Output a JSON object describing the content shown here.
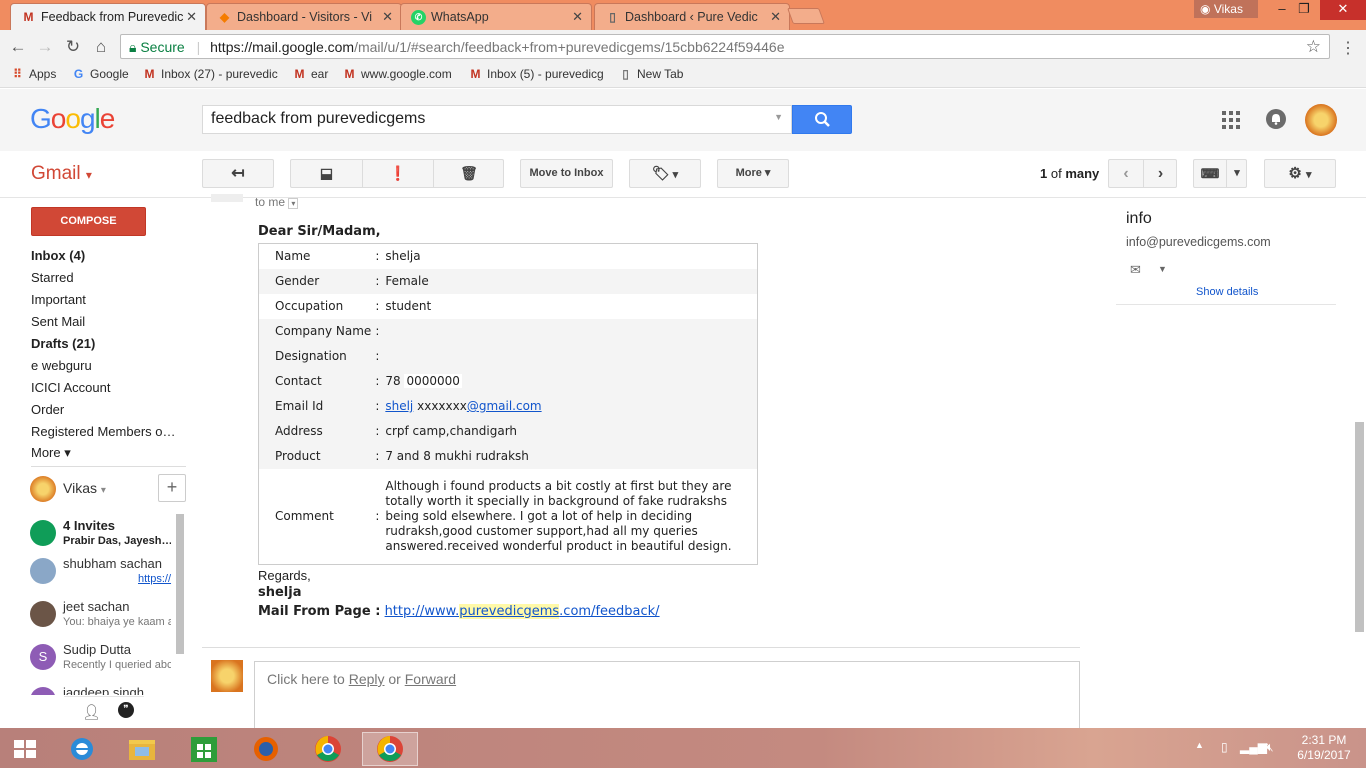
{
  "browser": {
    "tabs": [
      {
        "title": "Feedback from Purevedic",
        "icon": "gmail-icon",
        "active": true
      },
      {
        "title": "Dashboard - Visitors - Vi",
        "icon": "dashboard-icon",
        "active": false
      },
      {
        "title": "WhatsApp",
        "icon": "whatsapp-icon",
        "active": false
      },
      {
        "title": "Dashboard ‹ Pure Vedic",
        "icon": "page-icon",
        "active": false
      }
    ],
    "profile_name": "Vikas",
    "secure_label": "Secure",
    "url_host": "https://mail.google.com",
    "url_path": "/mail/u/1/#search/feedback+from+purevedicgems/15cbb6224f59446e",
    "bookmarks": [
      {
        "label": "Apps",
        "icon": "apps-grid-icon"
      },
      {
        "label": "Google",
        "icon": "google-g-icon"
      },
      {
        "label": "Inbox (27) - purevedic",
        "icon": "gmail-icon"
      },
      {
        "label": "ear",
        "icon": "gmail-icon"
      },
      {
        "label": "www.google.com",
        "icon": "gmail-icon"
      },
      {
        "label": "Inbox (5) - purevedicg",
        "icon": "gmail-icon"
      },
      {
        "label": "New Tab",
        "icon": "page-icon"
      }
    ]
  },
  "gmail": {
    "logo": "Google",
    "search_value": "feedback from purevedicgems",
    "app_label": "Gmail",
    "toolbar": {
      "move_to_inbox": "Move to Inbox",
      "more": "More",
      "page_count": "1",
      "page_of": "of",
      "page_total": "many"
    },
    "nav": {
      "compose": "COMPOSE",
      "items": [
        {
          "label": "Inbox (4)",
          "bold": true
        },
        {
          "label": "Starred",
          "bold": false
        },
        {
          "label": "Important",
          "bold": false
        },
        {
          "label": "Sent Mail",
          "bold": false
        },
        {
          "label": "Drafts (21)",
          "bold": true
        },
        {
          "label": "e webguru",
          "bold": false
        },
        {
          "label": "ICICI Account",
          "bold": false
        },
        {
          "label": "Order",
          "bold": false
        },
        {
          "label": "Registered Members o…",
          "bold": false
        },
        {
          "label": "More ▾",
          "bold": false
        }
      ],
      "chat_user": "Vikas",
      "chats": [
        {
          "name": "4 Invites",
          "sub": "Prabir Das, Jayesh…"
        },
        {
          "name": "shubham sachan",
          "sub": "https://"
        },
        {
          "name": "jeet sachan",
          "sub": "You: bhaiya ye kaam a"
        },
        {
          "name": "Sudip Dutta",
          "sub": "Recently I queried abc"
        },
        {
          "name": "jagdeep singh",
          "sub": ""
        }
      ]
    },
    "message": {
      "to_me": "to me",
      "greeting": "Dear Sir/Madam,",
      "fields": [
        {
          "label": "Name",
          "value": "shelja"
        },
        {
          "label": "Gender",
          "value": "Female"
        },
        {
          "label": "Occupation",
          "value": "student"
        },
        {
          "label": "Company Name",
          "value": ""
        },
        {
          "label": "Designation",
          "value": ""
        },
        {
          "label": "Contact",
          "value": "78"
        },
        {
          "label": "Email Id",
          "value": "shelj"
        },
        {
          "label": "Address",
          "value": "crpf camp,chandigarh"
        },
        {
          "label": "Product",
          "value": "7 and 8 mukhi rudraksh"
        },
        {
          "label": "Comment",
          "value": "Although i found products a bit costly at first but they are totally worth it specially in background of fake rudrakshs being sold elsewhere. I got a lot of help in deciding rudraksh,good customer support,had all my queries answered.received wonderful product in beautiful design."
        }
      ],
      "contact_mask": "0000000",
      "email_mask": "xxxxxxx",
      "email_domain": "@gmail.com",
      "regards": "Regards,",
      "sign": "shelja",
      "mail_from_label": "Mail From Page :",
      "url_pre": "http://www.",
      "url_hl": "purevedicgems",
      "url_post": ".com/feedback/",
      "reply_prefix": "Click here to",
      "reply": "Reply",
      "or": "or",
      "forward": "Forward"
    },
    "contact": {
      "name": "info",
      "email": "info@purevedicgems.com",
      "show_details": "Show details"
    }
  },
  "taskbar": {
    "time": "2:31 PM",
    "date": "6/19/2017"
  }
}
